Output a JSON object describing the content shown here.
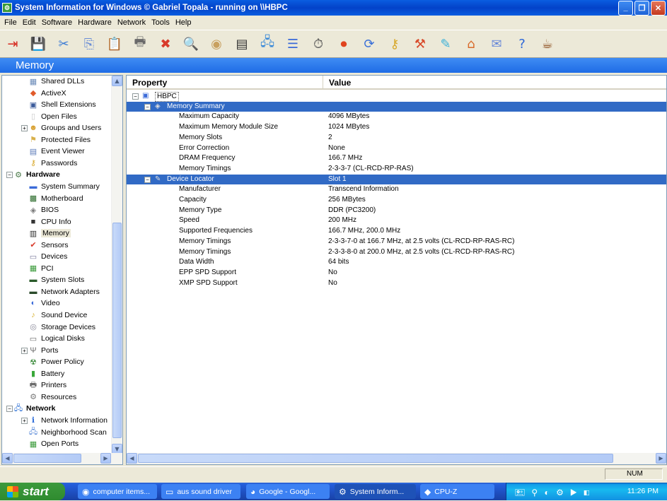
{
  "window": {
    "title": "System Information for Windows  © Gabriel Topala - running on \\\\HBPC",
    "controls": {
      "minimize": "_",
      "maximize": "❐",
      "close": "✕"
    }
  },
  "menu": [
    "File",
    "Edit",
    "Software",
    "Hardware",
    "Network",
    "Tools",
    "Help"
  ],
  "toolbar": [
    {
      "name": "exit-icon",
      "glyph": "⇥",
      "color": "#d6281e"
    },
    {
      "name": "save-icon",
      "glyph": "💾",
      "color": "#2d5fb4"
    },
    {
      "name": "cut-icon",
      "glyph": "✂",
      "color": "#3a7bd5"
    },
    {
      "name": "copy-icon",
      "glyph": "⎘",
      "color": "#6b8ed6"
    },
    {
      "name": "paste-icon",
      "glyph": "📋",
      "color": "#d8b04a"
    },
    {
      "name": "print-icon",
      "glyph": "🖶",
      "color": "#6a6a6a"
    },
    {
      "name": "stop-icon",
      "glyph": "✖",
      "color": "#d83a2a"
    },
    {
      "name": "find-icon",
      "glyph": "🔍",
      "color": "#d8a23a"
    },
    {
      "name": "browser-icon",
      "glyph": "◉",
      "color": "#c8a060"
    },
    {
      "name": "monitor-icon",
      "glyph": "▤",
      "color": "#333"
    },
    {
      "name": "network-icon",
      "glyph": "🖧",
      "color": "#3a8ad8"
    },
    {
      "name": "list-icon",
      "glyph": "☰",
      "color": "#3a6ad8"
    },
    {
      "name": "timer-icon",
      "glyph": "⏱",
      "color": "#555"
    },
    {
      "name": "record-icon",
      "glyph": "⏺",
      "color": "#e0441e"
    },
    {
      "name": "refresh-icon",
      "glyph": "⟳",
      "color": "#3a70d8"
    },
    {
      "name": "key-icon",
      "glyph": "⚷",
      "color": "#d8a82a"
    },
    {
      "name": "tools-icon",
      "glyph": "⚒",
      "color": "#d84a2a"
    },
    {
      "name": "wizard-icon",
      "glyph": "✎",
      "color": "#3ab0d8"
    },
    {
      "name": "home-icon",
      "glyph": "⌂",
      "color": "#d86a2a"
    },
    {
      "name": "mail-icon",
      "glyph": "✉",
      "color": "#6a8ad8"
    },
    {
      "name": "help-icon",
      "glyph": "?",
      "color": "#2a66d8"
    },
    {
      "name": "coffee-icon",
      "glyph": "☕",
      "color": "#8a4a1a"
    }
  ],
  "section_title": "Memory",
  "tree": [
    {
      "label": "Shared DLLs",
      "icon": "dll-icon",
      "glyph": "▦",
      "color": "#6a8ab8",
      "level": 2
    },
    {
      "label": "ActiveX",
      "icon": "activex-icon",
      "glyph": "◆",
      "color": "#e05a2a",
      "level": 2
    },
    {
      "label": "Shell Extensions",
      "icon": "shell-extensions-icon",
      "glyph": "▣",
      "color": "#3a5a9a",
      "level": 2
    },
    {
      "label": "Open Files",
      "icon": "open-files-icon",
      "glyph": "▯",
      "color": "#c8c8c8",
      "level": 2
    },
    {
      "label": "Groups and Users",
      "icon": "users-icon",
      "glyph": "☻",
      "color": "#d8a030",
      "level": 2,
      "expander": "+"
    },
    {
      "label": "Protected Files",
      "icon": "protected-files-icon",
      "glyph": "⚑",
      "color": "#d8b04a",
      "level": 2
    },
    {
      "label": "Event Viewer",
      "icon": "event-viewer-icon",
      "glyph": "▤",
      "color": "#5a7ab8",
      "level": 2
    },
    {
      "label": "Passwords",
      "icon": "passwords-icon",
      "glyph": "⚷",
      "color": "#d8a82a",
      "level": 2
    },
    {
      "label": "Hardware",
      "icon": "hardware-icon",
      "glyph": "⚙",
      "color": "#4a7a4a",
      "level": 1,
      "group": true,
      "expander": "−"
    },
    {
      "label": "System Summary",
      "icon": "system-summary-icon",
      "glyph": "▬",
      "color": "#3a6ad8",
      "level": 2
    },
    {
      "label": "Motherboard",
      "icon": "motherboard-icon",
      "glyph": "▩",
      "color": "#2a6a2a",
      "level": 2
    },
    {
      "label": "BIOS",
      "icon": "bios-icon",
      "glyph": "◈",
      "color": "#7a7a7a",
      "level": 2
    },
    {
      "label": "CPU Info",
      "icon": "cpu-icon",
      "glyph": "■",
      "color": "#333",
      "level": 2
    },
    {
      "label": "Memory",
      "icon": "memory-icon",
      "glyph": "▥",
      "color": "#2a2a2a",
      "level": 2,
      "selected": true
    },
    {
      "label": "Sensors",
      "icon": "sensors-icon",
      "glyph": "✔",
      "color": "#d83a2a",
      "level": 2
    },
    {
      "label": "Devices",
      "icon": "devices-icon",
      "glyph": "▭",
      "color": "#7a7a9a",
      "level": 2
    },
    {
      "label": "PCI",
      "icon": "pci-icon",
      "glyph": "▦",
      "color": "#3a9a3a",
      "level": 2
    },
    {
      "label": "System Slots",
      "icon": "system-slots-icon",
      "glyph": "▬",
      "color": "#2a5a2a",
      "level": 2
    },
    {
      "label": "Network Adapters",
      "icon": "network-adapters-icon",
      "glyph": "▬",
      "color": "#2a4a2a",
      "level": 2
    },
    {
      "label": "Video",
      "icon": "video-icon",
      "glyph": "◐",
      "color": "#3a6ad8",
      "level": 2
    },
    {
      "label": "Sound Device",
      "icon": "sound-icon",
      "glyph": "♪",
      "color": "#d8b030",
      "level": 2
    },
    {
      "label": "Storage Devices",
      "icon": "storage-icon",
      "glyph": "◎",
      "color": "#8a8a9a",
      "level": 2
    },
    {
      "label": "Logical Disks",
      "icon": "logical-disks-icon",
      "glyph": "▭",
      "color": "#6a6a6a",
      "level": 2
    },
    {
      "label": "Ports",
      "icon": "ports-icon",
      "glyph": "Ψ",
      "color": "#6a6a6a",
      "level": 2,
      "expander": "+"
    },
    {
      "label": "Power Policy",
      "icon": "power-policy-icon",
      "glyph": "☢",
      "color": "#3a8a3a",
      "level": 2
    },
    {
      "label": "Battery",
      "icon": "battery-icon",
      "glyph": "▮",
      "color": "#3aa83a",
      "level": 2
    },
    {
      "label": "Printers",
      "icon": "printers-icon",
      "glyph": "🖶",
      "color": "#6a6a6a",
      "level": 2
    },
    {
      "label": "Resources",
      "icon": "resources-icon",
      "glyph": "⚙",
      "color": "#7a7a7a",
      "level": 2
    },
    {
      "label": "Network",
      "icon": "network-tree-icon",
      "glyph": "🖧",
      "color": "#3a7ad8",
      "level": 1,
      "group": true,
      "expander": "−"
    },
    {
      "label": "Network Information",
      "icon": "network-info-icon",
      "glyph": "ℹ",
      "color": "#2a6ad8",
      "level": 2,
      "expander": "+"
    },
    {
      "label": "Neighborhood Scan",
      "icon": "neighborhood-scan-icon",
      "glyph": "🖧",
      "color": "#5a8ad8",
      "level": 2
    },
    {
      "label": "Open Ports",
      "icon": "open-ports-icon",
      "glyph": "▦",
      "color": "#3a9a3a",
      "level": 2
    }
  ],
  "table": {
    "headers": {
      "property": "Property",
      "value": "Value"
    },
    "root": "HBPC",
    "rows": [
      {
        "type": "section",
        "property": "Memory Summary",
        "value": "",
        "icon": "memory-summary-icon",
        "glyph": "◈",
        "highlight": true
      },
      {
        "type": "item",
        "property": "Maximum Capacity",
        "value": "4096 MBytes"
      },
      {
        "type": "item",
        "property": "Maximum Memory Module Size",
        "value": "1024 MBytes"
      },
      {
        "type": "item",
        "property": "Memory Slots",
        "value": "2"
      },
      {
        "type": "item",
        "property": "Error Correction",
        "value": "None"
      },
      {
        "type": "item",
        "property": "DRAM Frequency",
        "value": "166.7 MHz"
      },
      {
        "type": "item",
        "property": "Memory Timings",
        "value": "2-3-3-7 (CL-RCD-RP-RAS)"
      },
      {
        "type": "section",
        "property": "Device Locator",
        "value": "Slot 1",
        "icon": "memory-module-icon",
        "glyph": "✎",
        "highlight": true
      },
      {
        "type": "item",
        "property": "Manufacturer",
        "value": "Transcend Information"
      },
      {
        "type": "item",
        "property": "Capacity",
        "value": "256 MBytes"
      },
      {
        "type": "item",
        "property": "Memory Type",
        "value": "DDR (PC3200)"
      },
      {
        "type": "item",
        "property": "Speed",
        "value": "200 MHz"
      },
      {
        "type": "item",
        "property": "Supported Frequencies",
        "value": "166.7 MHz, 200.0 MHz"
      },
      {
        "type": "item",
        "property": "Memory Timings",
        "value": "2-3-3-7-0 at 166.7 MHz, at 2.5 volts (CL-RCD-RP-RAS-RC)"
      },
      {
        "type": "item",
        "property": "Memory Timings",
        "value": "2-3-3-8-0 at 200.0 MHz, at 2.5 volts (CL-RCD-RP-RAS-RC)"
      },
      {
        "type": "item",
        "property": "Data Width",
        "value": "64 bits"
      },
      {
        "type": "item",
        "property": "EPP SPD Support",
        "value": "No"
      },
      {
        "type": "item",
        "property": "XMP SPD Support",
        "value": "No"
      }
    ]
  },
  "status": {
    "num": "NUM"
  },
  "taskbar": {
    "start": "start",
    "tasks": [
      {
        "label": "computer items...",
        "glyph": "◉",
        "icon": "firefox-icon"
      },
      {
        "label": "aus sound driver",
        "glyph": "▭",
        "icon": "folder-icon"
      },
      {
        "label": "Google - Googl...",
        "glyph": "◕",
        "icon": "browser-task-icon"
      },
      {
        "label": "System Inform...",
        "glyph": "⚙",
        "icon": "sysinfo-task-icon",
        "active": true
      },
      {
        "label": "CPU-Z",
        "glyph": "◆",
        "icon": "cpuz-icon"
      }
    ],
    "tray_icons": "🖭 ⚲ ◐ ⚙ ▶ ◧",
    "clock": "11:26 PM"
  }
}
